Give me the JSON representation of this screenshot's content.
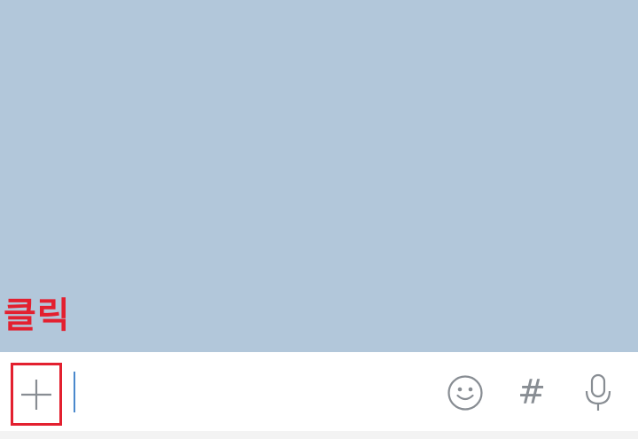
{
  "annotation": {
    "label": "클릭",
    "color": "#e3202f"
  },
  "chat": {
    "background_color": "#b2c7da"
  },
  "input_bar": {
    "plus_icon": "plus-icon",
    "message_placeholder": "",
    "message_value": "",
    "emoji_icon": "smiley-icon",
    "hashtag_label": "#",
    "mic_icon": "microphone-icon",
    "icon_color": "#888d93",
    "caret_color": "#4a88cc"
  }
}
